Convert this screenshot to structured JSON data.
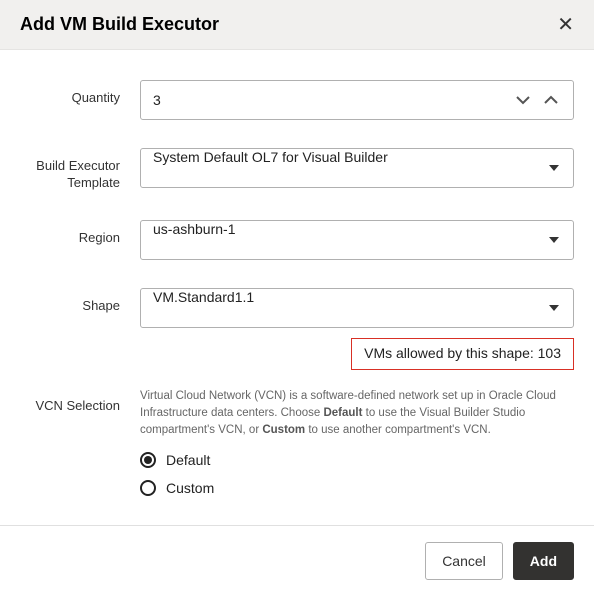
{
  "header": {
    "title": "Add VM Build Executor"
  },
  "form": {
    "quantity": {
      "label": "Quantity",
      "value": "3"
    },
    "template": {
      "label": "Build Executor Template",
      "value": "System Default OL7 for Visual Builder"
    },
    "region": {
      "label": "Region",
      "value": "us-ashburn-1"
    },
    "shape": {
      "label": "Shape",
      "value": "VM.Standard1.1",
      "vms_allowed": "VMs allowed by this shape: 103"
    },
    "vcn": {
      "label": "VCN Selection",
      "description_pre": "Virtual Cloud Network (VCN) is a software-defined network set up in Oracle Cloud Infrastructure data centers. Choose ",
      "description_mid1": "Default",
      "description_mid2": " to use the Visual Builder Studio compartment's VCN, or ",
      "description_mid3": "Custom",
      "description_post": " to use another compartment's VCN.",
      "options": {
        "default": "Default",
        "custom": "Custom"
      }
    }
  },
  "footer": {
    "cancel": "Cancel",
    "add": "Add"
  }
}
